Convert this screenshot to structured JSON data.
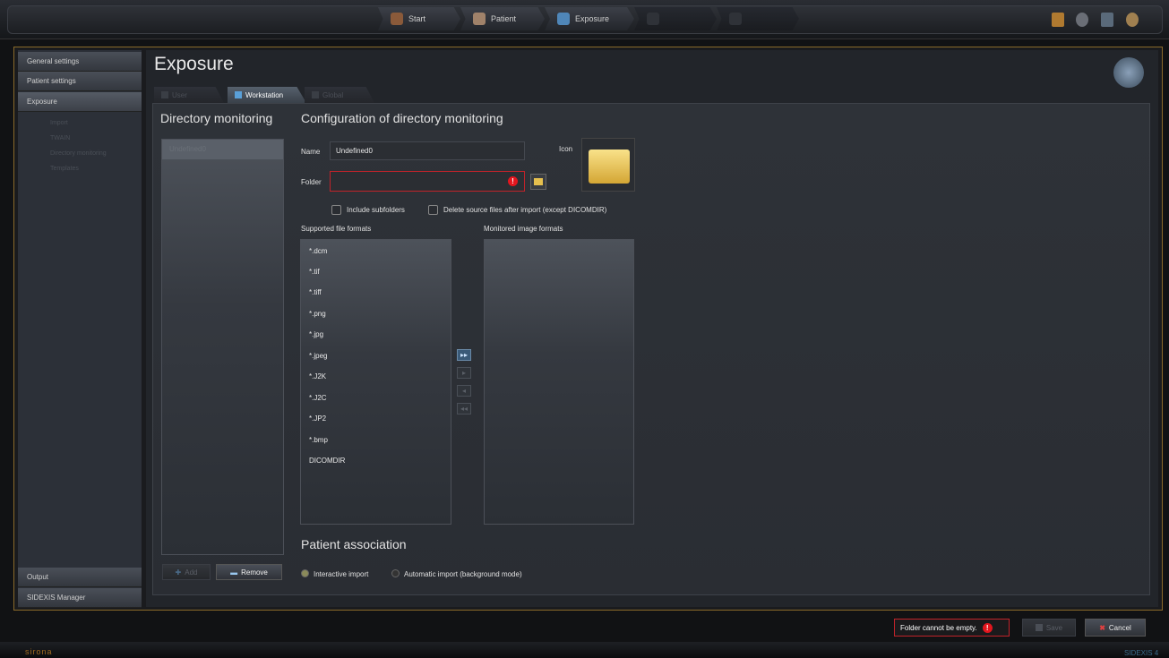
{
  "workflow": {
    "steps": [
      {
        "label": "Start"
      },
      {
        "label": "Patient"
      },
      {
        "label": "Exposure"
      },
      {
        "label": ""
      },
      {
        "label": ""
      }
    ]
  },
  "topbar": {
    "icons": [
      "door-icon",
      "gear-icon",
      "monitor-icon",
      "user-icon"
    ]
  },
  "sidebar": {
    "items": [
      {
        "label": "General settings"
      },
      {
        "label": "Patient settings"
      },
      {
        "label": "Exposure"
      }
    ],
    "subitems": [
      {
        "label": "Import"
      },
      {
        "label": "TWAIN"
      },
      {
        "label": "Directory monitoring"
      },
      {
        "label": "Templates"
      }
    ],
    "bottom": [
      {
        "label": "Output"
      },
      {
        "label": "SIDEXIS Manager"
      }
    ]
  },
  "page": {
    "title": "Exposure"
  },
  "tabs": [
    {
      "label": "User"
    },
    {
      "label": "Workstation"
    },
    {
      "label": "Global"
    }
  ],
  "left": {
    "heading": "Directory monitoring",
    "items": [
      {
        "label": "Undefined0"
      }
    ],
    "add_label": "Add",
    "remove_label": "Remove"
  },
  "config": {
    "heading": "Configuration of directory monitoring",
    "name_label": "Name",
    "name_value": "Undefined0",
    "icon_label": "Icon",
    "folder_label": "Folder",
    "folder_value": "",
    "include_subfolders": "Include subfolders",
    "delete_source": "Delete source files after import (except DICOMDIR)",
    "supported_label": "Supported file formats",
    "monitored_label": "Monitored image formats",
    "formats": [
      "*.dcm",
      "*.tif",
      "*.tiff",
      "*.png",
      "*.jpg",
      "*.jpeg",
      "*.J2K",
      "*.J2C",
      "*.JP2",
      "*.bmp",
      "DICOMDIR"
    ],
    "arrows": [
      "▸▸",
      "▸",
      "◂",
      "◂◂"
    ]
  },
  "association": {
    "heading": "Patient association",
    "interactive": "Interactive import",
    "automatic": "Automatic import (background mode)"
  },
  "footer": {
    "error": "Folder cannot be empty.",
    "save_label": "Save",
    "cancel_label": "Cancel"
  },
  "status": {
    "brand": "sirona",
    "product": "SIDEXIS 4"
  }
}
